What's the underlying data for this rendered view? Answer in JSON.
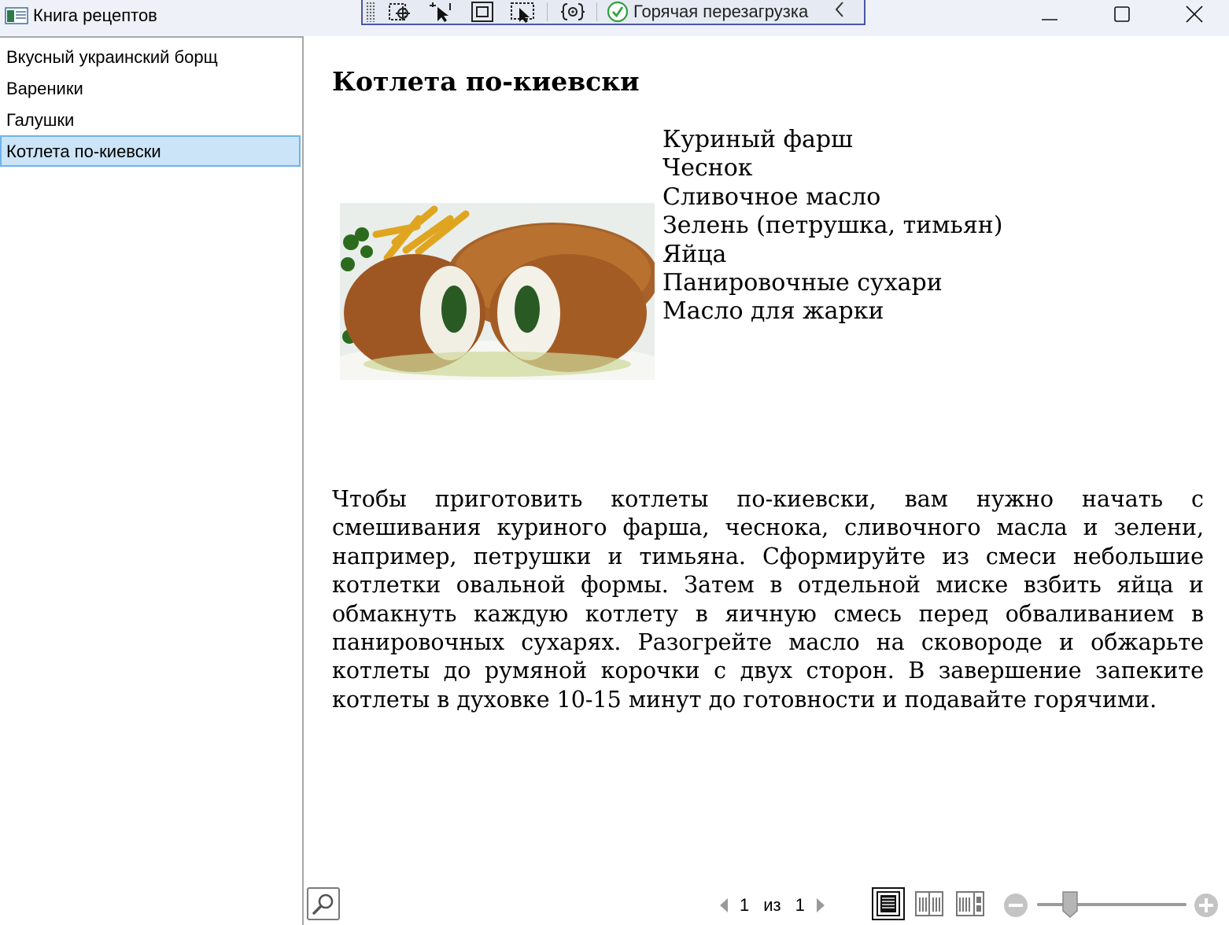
{
  "window": {
    "title": "Книга рецептов",
    "icon": "app-window-icon",
    "controls": {
      "minimize": "minimize-icon",
      "maximize": "maximize-icon",
      "close": "close-icon"
    }
  },
  "debug_toolbar": {
    "tools": [
      "select-element-icon",
      "pointer-select-icon",
      "display-layout-adorners-icon",
      "track-focus-icon",
      "binding-failures-icon"
    ],
    "hot_reload_label": "Горячая перезагрузка",
    "hot_reload_status_icon": "check-circle-icon",
    "collapse_icon": "chevron-left-icon"
  },
  "sidebar": {
    "items": [
      {
        "label": "Вкусный украинский борщ",
        "selected": false
      },
      {
        "label": "Вареники",
        "selected": false
      },
      {
        "label": "Галушки",
        "selected": false
      },
      {
        "label": "Котлета по-киевски",
        "selected": true
      }
    ]
  },
  "document": {
    "title": "Котлета по-киевски",
    "image": "chicken-kiev-photo",
    "ingredients": [
      "Куриный фарш",
      "Чеснок",
      "Сливочное масло",
      "Зелень (петрушка, тимьян)",
      "Яйца",
      "Панировочные сухари",
      "Масло для жарки"
    ],
    "instructions": "Чтобы приготовить котлеты по-киевски, вам нужно начать с смешивания куриного фарша, чеснока, сливочного масла и зелени, например, петрушки и тимьяна. Сформируйте из смеси небольшие котлетки овальной формы. Затем в отдельной миске взбить яйца и обмакнуть каждую котлету в яичную смесь перед обваливанием в панировочных сухарях. Разогрейте масло на сковороде и обжарьте котлеты до румяной корочки с двух сторон. В завершение запеките котлеты в духовке 10-15 минут до готовности и подавайте горячими."
  },
  "viewer_toolbar": {
    "find_icon": "search-icon",
    "page_current": "1",
    "page_of": "из",
    "page_total": "1",
    "view_modes": [
      "single-page-icon",
      "two-pages-icon",
      "thumbnails-icon"
    ],
    "active_view_mode": "single-page-icon",
    "zoom_out_icon": "zoom-out-icon",
    "zoom_in_icon": "zoom-in-icon",
    "zoom_level_fraction": 0.22
  },
  "colors": {
    "titlebar_bg": "#eef2f8",
    "selection_bg": "#cce4f7",
    "selection_border": "#6fb4e8",
    "debug_toolbar_border": "#4a56a3",
    "hot_reload_check": "#2e9e3c"
  }
}
